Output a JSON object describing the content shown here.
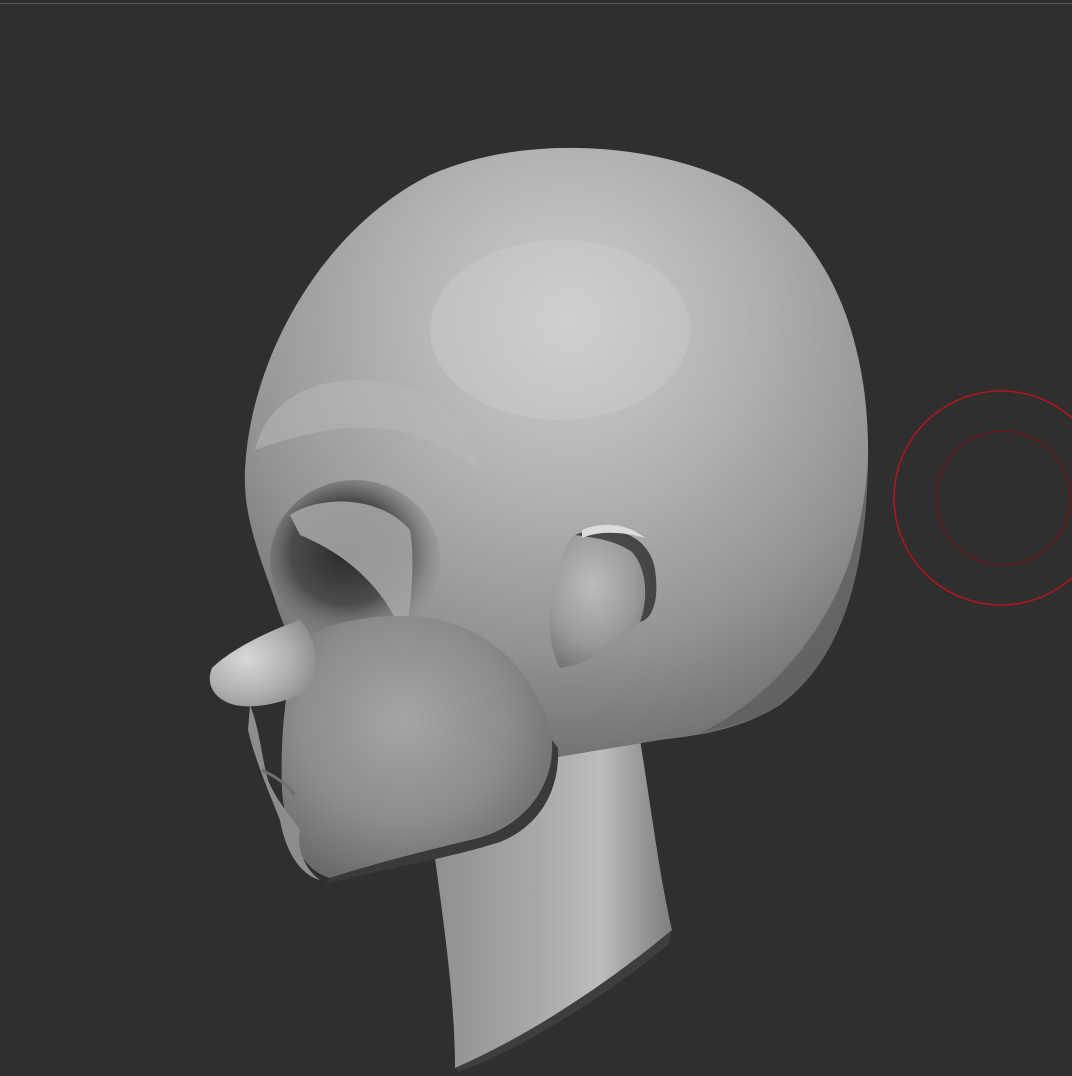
{
  "viewport": {
    "background_color": "#2f2f2f",
    "model": "sculpted-head-profile",
    "material_color": "#a8a8a8"
  },
  "brush_cursor": {
    "outer_ring_color": "#b3161c",
    "inner_ring_color": "#6a1a1c"
  }
}
